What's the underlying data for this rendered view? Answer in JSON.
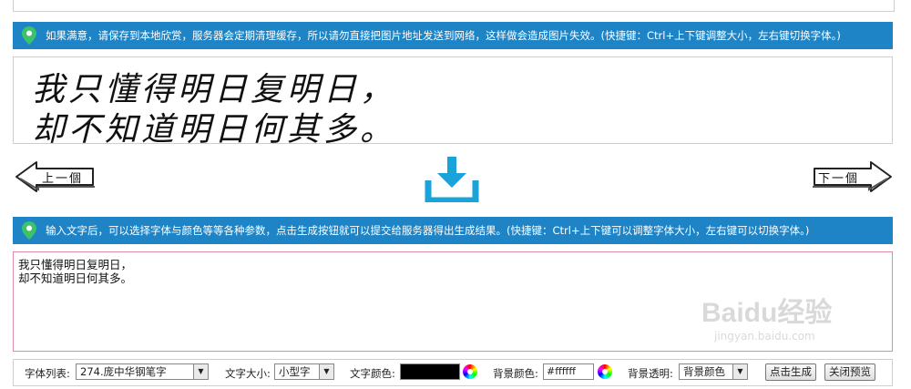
{
  "notice_top": "如果满意，请保存到本地欣赏，服务器会定期清理缓存，所以请勿直接把图片地址发送到网络，这样做会造成图片失效。(快捷键：Ctrl+上下键调整大小，左右键切换字体。)",
  "preview": {
    "line1": "我只懂得明日复明日，",
    "line2": "却不知道明日何其多。"
  },
  "nav": {
    "prev_label": "上一個",
    "next_label": "下一個"
  },
  "notice_input": "输入文字后，可以选择字体与颜色等等各种参数，点击生成按钮就可以提交给服务器得出生成结果。(快捷键：Ctrl+上下键可以调整字体大小，左右键可以切换字体。)",
  "input_text": "我只懂得明日复明日，\n却不知道明日何其多。",
  "controls": {
    "font_list_label": "字体列表:",
    "font_list_value": "274.庞中华钢笔字",
    "text_size_label": "文字大小:",
    "text_size_value": "小型字",
    "text_color_label": "文字颜色:",
    "text_color": "#000000",
    "bg_color_label": "背景颜色:",
    "bg_color_value": "#ffffff",
    "bg_transparent_label": "背景透明:",
    "bg_transparent_value": "背景颜色",
    "generate_button": "点击生成",
    "close_preview_button": "关闭预览"
  },
  "accent_color": "#1e84c6",
  "watermark": {
    "brand": "Baidu经验",
    "url": "jingyan.baidu.com"
  }
}
